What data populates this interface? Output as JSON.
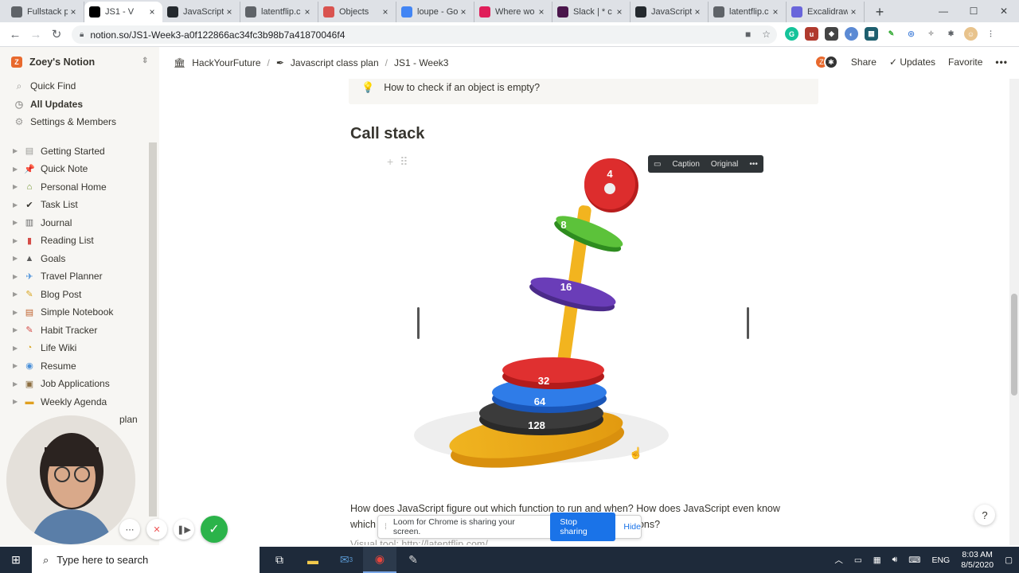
{
  "browser": {
    "tabs": [
      {
        "title": "Fullstack p",
        "icon": "page-icon",
        "color": "#5f6368",
        "active": false
      },
      {
        "title": "JS1 - V",
        "icon": "notion-icon",
        "color": "#000000",
        "active": true
      },
      {
        "title": "JavaScript",
        "icon": "github-icon",
        "color": "#24292e",
        "active": false
      },
      {
        "title": "latentflip.c",
        "icon": "globe-icon",
        "color": "#5f6368",
        "active": false
      },
      {
        "title": "Objects",
        "icon": "mdn-icon",
        "color": "#d9534f",
        "active": false
      },
      {
        "title": "loupe - Go",
        "icon": "google-icon",
        "color": "#4285f4",
        "active": false
      },
      {
        "title": "Where wo",
        "icon": "slack-icon",
        "color": "#e01e5a",
        "active": false
      },
      {
        "title": "Slack | * c",
        "icon": "slack-square-icon",
        "color": "#4a154b",
        "active": false
      },
      {
        "title": "JavaScript",
        "icon": "github-icon",
        "color": "#24292e",
        "active": false
      },
      {
        "title": "latentflip.c",
        "icon": "globe-icon",
        "color": "#5f6368",
        "active": false
      },
      {
        "title": "Excalidraw",
        "icon": "excalidraw-icon",
        "color": "#6965db",
        "active": false
      }
    ],
    "url": "notion.so/JS1-Week3-a0f122866ac34fc3b98b7a41870046f4",
    "new_tab": "+"
  },
  "sidebar": {
    "workspace_initial": "Z",
    "workspace_name": "Zoey's Notion",
    "nav": [
      {
        "label": "Quick Find",
        "icon": "search-icon",
        "glyph": "⌕",
        "bold": false
      },
      {
        "label": "All Updates",
        "icon": "clock-icon",
        "glyph": "◷",
        "bold": true
      },
      {
        "label": "Settings & Members",
        "icon": "gear-icon",
        "glyph": "⚙",
        "bold": false
      }
    ],
    "pages": [
      {
        "label": "Getting Started",
        "icon": "document-icon",
        "glyph": "▤",
        "color": "#9b9a97"
      },
      {
        "label": "Quick Note",
        "icon": "pushpin-icon",
        "glyph": "📌",
        "color": "#e03e3e"
      },
      {
        "label": "Personal Home",
        "icon": "house-icon",
        "glyph": "⌂",
        "color": "#6b8e23"
      },
      {
        "label": "Task List",
        "icon": "checkmark-icon",
        "glyph": "✔",
        "color": "#37352f"
      },
      {
        "label": "Journal",
        "icon": "notebook-icon",
        "glyph": "▥",
        "color": "#6b6b6b"
      },
      {
        "label": "Reading List",
        "icon": "book-icon",
        "glyph": "▮",
        "color": "#d44c47"
      },
      {
        "label": "Goals",
        "icon": "mountain-icon",
        "glyph": "▲",
        "color": "#5c5c5c"
      },
      {
        "label": "Travel Planner",
        "icon": "airplane-icon",
        "glyph": "✈",
        "color": "#4a90d9"
      },
      {
        "label": "Blog Post",
        "icon": "pencil-icon",
        "glyph": "✎",
        "color": "#d9a520"
      },
      {
        "label": "Simple Notebook",
        "icon": "notebook-icon",
        "glyph": "▤",
        "color": "#c0622f"
      },
      {
        "label": "Habit Tracker",
        "icon": "pencil-icon",
        "glyph": "✎",
        "color": "#d44c47"
      },
      {
        "label": "Life Wiki",
        "icon": "clock-icon",
        "glyph": "◔",
        "color": "#d9a520"
      },
      {
        "label": "Resume",
        "icon": "person-icon",
        "glyph": "◉",
        "color": "#4a90d9"
      },
      {
        "label": "Job Applications",
        "icon": "inbox-icon",
        "glyph": "▣",
        "color": "#8b6d3f"
      },
      {
        "label": "Weekly Agenda",
        "icon": "notebook-icon",
        "glyph": "▬",
        "color": "#e0a020"
      }
    ],
    "partial_items": [
      "plan"
    ]
  },
  "breadcrumb": {
    "items": [
      {
        "label": "HackYourFuture",
        "icon": "building-icon",
        "glyph": "🏛"
      },
      {
        "label": "Javascript class plan",
        "icon": "pen-icon",
        "glyph": "✒"
      },
      {
        "label": "JS1 - Week3",
        "icon": "",
        "glyph": ""
      }
    ],
    "separator": "/"
  },
  "topbar": {
    "share": "Share",
    "updates": "Updates",
    "favorite": "Favorite",
    "more": "•••",
    "avatar_initial": "Z"
  },
  "content": {
    "callout_text": "How to check if an object is empty?",
    "heading": "Call stack",
    "image_toolbar": {
      "caption": "Caption",
      "original": "Original",
      "more": "•••"
    },
    "rings": [
      "4",
      "8",
      "16",
      "32",
      "64",
      "128"
    ],
    "paragraph_line1": "How does JavaScript figure out which function to run and when? How does JavaScript even know",
    "paragraph_line2_start": "which",
    "paragraph_line2_end": "ons?",
    "visual_tool_label": "Visual tool:",
    "visual_tool_link": "http://latentflip.com/"
  },
  "loom": {
    "message": "Loom for Chrome is sharing your screen.",
    "stop": "Stop sharing",
    "hide": "Hide"
  },
  "help": "?",
  "taskbar": {
    "search_placeholder": "Type here to search",
    "lang": "ENG",
    "time": "8:03 AM",
    "date": "8/5/2020",
    "mail_badge": "3"
  }
}
